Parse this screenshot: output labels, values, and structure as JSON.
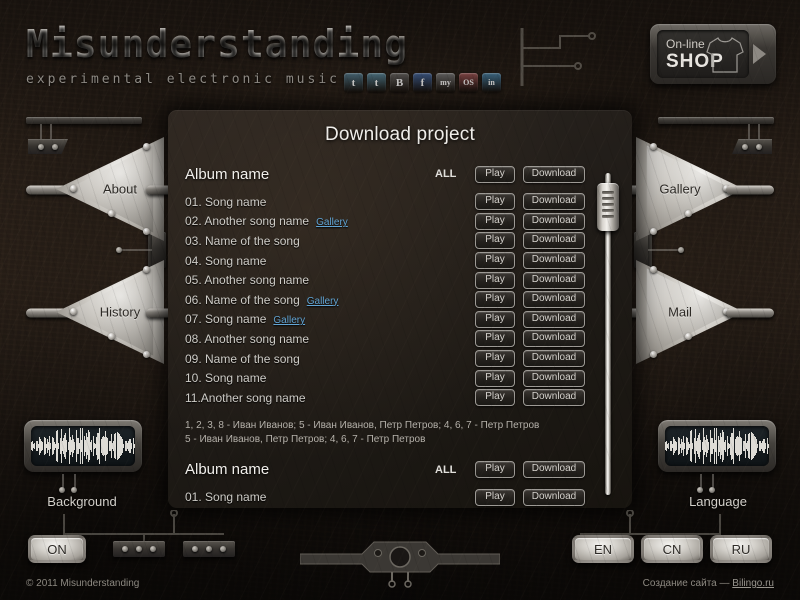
{
  "site": {
    "logo": "Misunderstanding",
    "tagline": "experimental electronic music",
    "accent_blue": "#63a6d6",
    "panel_bg": "#221e19"
  },
  "social": [
    {
      "name": "twitter-icon",
      "glyph": "t",
      "color": "#4a6e80"
    },
    {
      "name": "twitter-alt-icon",
      "glyph": "t",
      "color": "#4f7a8c"
    },
    {
      "name": "blogger-icon",
      "glyph": "B",
      "color": "#5c5a58"
    },
    {
      "name": "facebook-icon",
      "glyph": "f",
      "color": "#3b5a8c"
    },
    {
      "name": "myspace-icon",
      "glyph": "my",
      "color": "#6a6a6a"
    },
    {
      "name": "lastfm-icon",
      "glyph": "OS",
      "color": "#8c4a4a"
    },
    {
      "name": "linkedin-icon",
      "glyph": "in",
      "color": "#3f7293"
    }
  ],
  "shop": {
    "line1": "On-line",
    "line2": "SHOP"
  },
  "nav": {
    "left": [
      {
        "label": "About"
      },
      {
        "label": "History"
      }
    ],
    "right": [
      {
        "label": "Gallery"
      },
      {
        "label": "Mail"
      }
    ]
  },
  "panel": {
    "title": "Download project",
    "all_label": "ALL",
    "play_label": "Play",
    "download_label": "Download",
    "gallery_label": "Gallery",
    "albums": [
      {
        "name": "Album name",
        "songs": [
          {
            "title": "01. Song name",
            "gallery": false
          },
          {
            "title": "02. Another song name",
            "gallery": true
          },
          {
            "title": "03. Name of the song",
            "gallery": false
          },
          {
            "title": "04. Song name",
            "gallery": false
          },
          {
            "title": "05. Another song name",
            "gallery": false
          },
          {
            "title": "06. Name of the song",
            "gallery": true
          },
          {
            "title": "07. Song name",
            "gallery": true
          },
          {
            "title": "08. Another song name",
            "gallery": false
          },
          {
            "title": "09. Name of the song",
            "gallery": false
          },
          {
            "title": "10. Song name",
            "gallery": false
          },
          {
            "title": "11.Another song name",
            "gallery": false
          }
        ],
        "credits": [
          "1, 2, 3, 8 - Иван Иванов; 5 -  Иван Иванов, Петр Петров; 4, 6, 7 - Петр Петров",
          "5 -  Иван Иванов, Петр Петров; 4, 6, 7 - Петр Петров"
        ]
      },
      {
        "name": "Album name",
        "songs": [
          {
            "title": "01. Song name",
            "gallery": false
          }
        ],
        "credits": []
      }
    ]
  },
  "controls": {
    "background_label": "Background",
    "language_label": "Language",
    "power_label": "ON",
    "languages": [
      {
        "label": "EN"
      },
      {
        "label": "CN"
      },
      {
        "label": "RU"
      }
    ]
  },
  "footer": {
    "copyright": "© 2011 Misunderstanding",
    "credit_prefix": "Создание сайта — ",
    "credit_link": "Bilingo.ru"
  }
}
